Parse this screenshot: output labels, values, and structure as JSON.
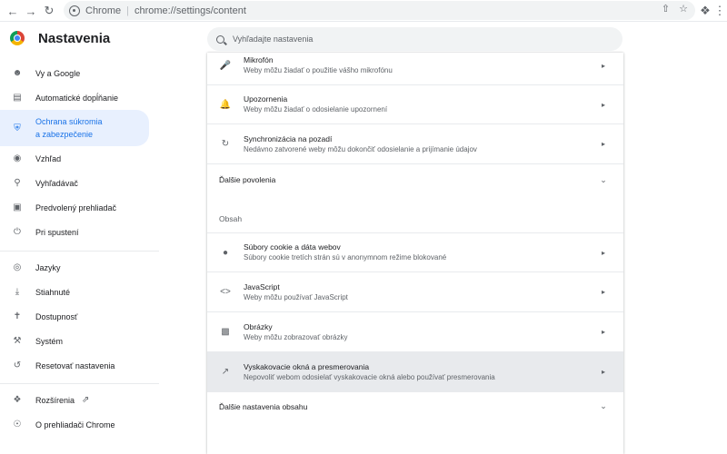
{
  "browser": {
    "origin": "Chrome",
    "url": "chrome://settings/content"
  },
  "header": {
    "title": "Nastavenia",
    "search_placeholder": "Vyhľadajte nastavenia"
  },
  "sidebar": {
    "items": [
      {
        "label": "Vy a Google",
        "icon": "person-icon"
      },
      {
        "label": "Automatické dopĺňanie",
        "icon": "clipboard-icon"
      },
      {
        "label": "Ochrana súkromia\na zabezpečenie",
        "icon": "shield-icon"
      },
      {
        "label": "Vzhľad",
        "icon": "palette-icon"
      },
      {
        "label": "Vyhľadávač",
        "icon": "search-icon"
      },
      {
        "label": "Predvolený prehliadač",
        "icon": "browser-icon"
      },
      {
        "label": "Pri spustení",
        "icon": "power-icon"
      },
      {
        "label": "Jazyky",
        "icon": "globe-icon"
      },
      {
        "label": "Stiahnuté",
        "icon": "download-icon"
      },
      {
        "label": "Dostupnosť",
        "icon": "accessibility-icon"
      },
      {
        "label": "Systém",
        "icon": "wrench-icon"
      },
      {
        "label": "Resetovať nastavenia",
        "icon": "reset-icon"
      },
      {
        "label": "Rozšírenia",
        "icon": "puzzle-icon"
      },
      {
        "label": "O prehliadači Chrome",
        "icon": "chrome-icon"
      }
    ]
  },
  "content": {
    "rows_top": [
      {
        "title": "Mikrofón",
        "desc": "Weby môžu žiadať o použitie vášho mikrofónu",
        "icon": "microphone-icon"
      },
      {
        "title": "Upozornenia",
        "desc": "Weby môžu žiadať o odosielanie upozornení",
        "icon": "bell-icon"
      },
      {
        "title": "Synchronizácia na pozadí",
        "desc": "Nedávno zatvorené weby môžu dokončiť odosielanie a prijímanie údajov",
        "icon": "sync-icon"
      }
    ],
    "more_permissions": "Ďalšie povolenia",
    "section_title": "Obsah",
    "rows_content": [
      {
        "title": "Súbory cookie a dáta webov",
        "desc": "Súbory cookie tretích strán sú v anonymnom režime blokované",
        "icon": "cookie-icon"
      },
      {
        "title": "JavaScript",
        "desc": "Weby môžu používať JavaScript",
        "icon": "code-icon"
      },
      {
        "title": "Obrázky",
        "desc": "Weby môžu zobrazovať obrázky",
        "icon": "image-icon"
      },
      {
        "title": "Vyskakovacie okná a presmerovania",
        "desc": "Nepovoliť webom odosielať vyskakovacie okná alebo používať presmerovania",
        "icon": "popup-icon"
      }
    ],
    "more_content": "Ďalšie nastavenia obsahu"
  }
}
